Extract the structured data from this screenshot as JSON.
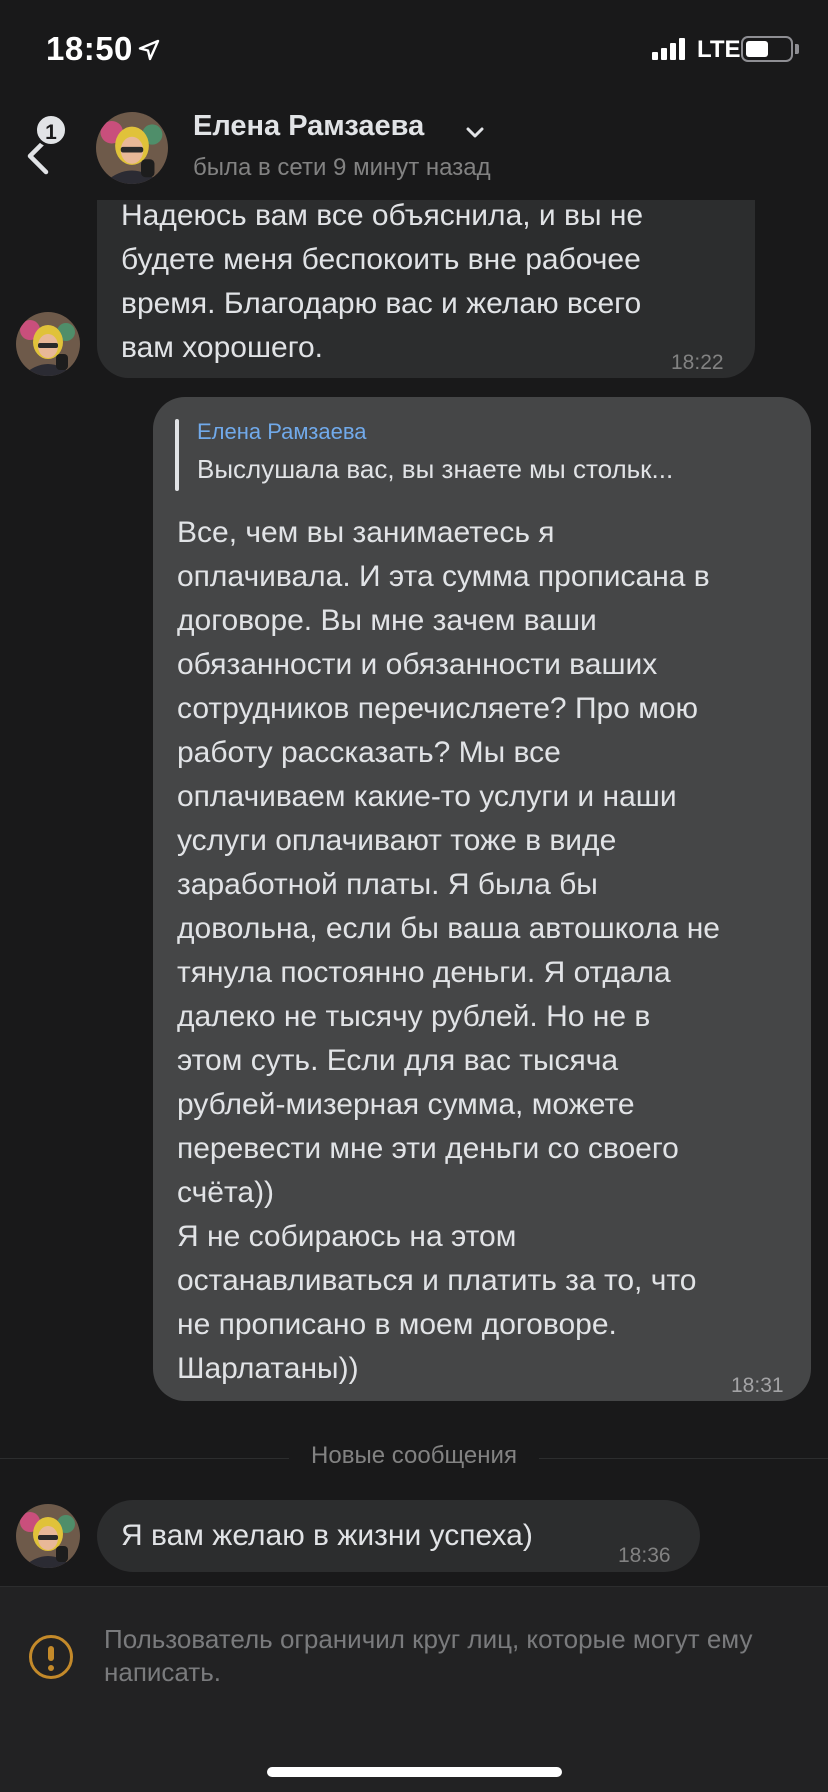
{
  "status_bar": {
    "time": "18:50",
    "network": "LTE",
    "icons": [
      "location-arrow-icon",
      "signal-bars-icon",
      "battery-icon"
    ]
  },
  "header": {
    "back_badge": "1",
    "contact_name": "Елена Рамзаева",
    "contact_status": "была в сети 9 минут назад"
  },
  "messages": [
    {
      "direction": "incoming",
      "text": "Надеюсь вам все объяснила, и вы не\nбудете меня беспокоить вне рабочее\nвремя. Благодарю вас и желаю всего\nвам хорошего.",
      "time": "18:22"
    },
    {
      "direction": "outgoing",
      "reply": {
        "author": "Елена Рамзаева",
        "preview": "Выслушала вас, вы знаете мы стольк..."
      },
      "text": "Все, чем вы занимаетесь я\nоплачивала. И эта сумма прописана в\nдоговоре. Вы мне зачем ваши\nобязанности и обязанности ваших\nсотрудников перечисляете? Про мою\nработу рассказать? Мы все\nоплачиваем какие-то услуги и наши\nуслуги оплачивают тоже в виде\nзаработной платы. Я была бы\nдовольна, если бы ваша автошкола не\nтянула постоянно деньги. Я отдала\nдалеко не тысячу рублей. Но не в\nэтом суть. Если для вас тысяча\nрублей-мизерная сумма, можете\nперевести мне эти деньги со своего\nсчёта))\nЯ не собираюсь на этом\nостанавливаться и платить за то, что\nне прописано в моем договоре.\nШарлатаны))",
      "time": "18:31"
    },
    {
      "direction": "incoming",
      "text": "Я вам желаю в жизни успеха)",
      "time": "18:36"
    }
  ],
  "divider": {
    "label": "Новые сообщения"
  },
  "restriction": {
    "text": "Пользователь ограничил круг лиц, которые могут ему написать.",
    "accent": "#c48a2a"
  },
  "colors": {
    "background": "#19191a",
    "incoming_bubble": "#2c2d2e",
    "outgoing_bubble": "#454647",
    "link": "#71aaeb"
  }
}
